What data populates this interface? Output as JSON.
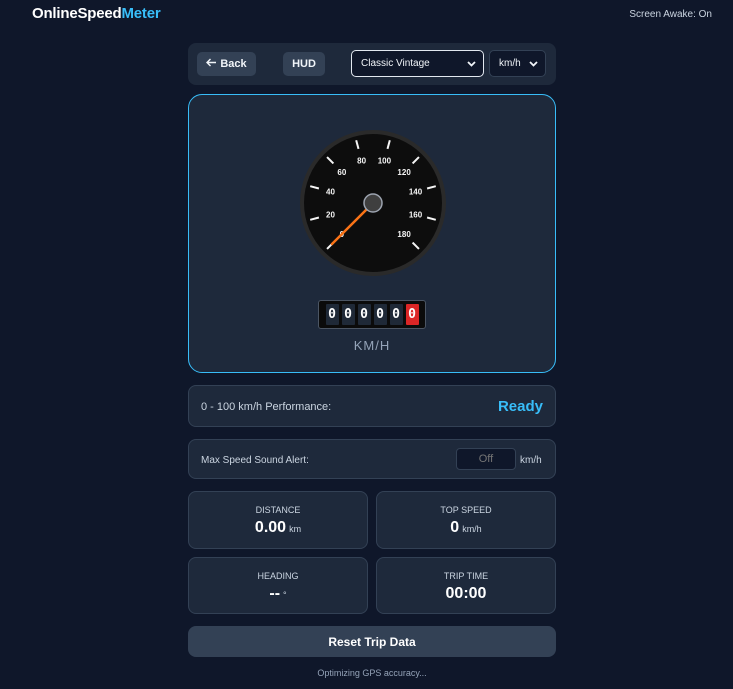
{
  "header": {
    "logo_part1": "OnlineSpeed",
    "logo_part2": "Meter",
    "screen_awake": "Screen Awake: On"
  },
  "toolbar": {
    "back_label": "Back",
    "hud_label": "HUD",
    "theme_selected": "Classic Vintage",
    "unit_selected": "km/h"
  },
  "gauge": {
    "ticks": [
      "0",
      "20",
      "40",
      "60",
      "80",
      "100",
      "120",
      "140",
      "160",
      "180"
    ],
    "speed": 0,
    "odometer_digits": [
      "0",
      "0",
      "0",
      "0",
      "0",
      "0"
    ],
    "unit": "KM/H"
  },
  "performance": {
    "label": "0 - 100 km/h Performance:",
    "status": "Ready"
  },
  "alert": {
    "label": "Max Speed Sound Alert:",
    "placeholder": "Off",
    "unit": "km/h"
  },
  "stats": {
    "distance": {
      "label": "Distance",
      "value": "0.00",
      "unit": "km"
    },
    "top_speed": {
      "label": "Top Speed",
      "value": "0",
      "unit": "km/h"
    },
    "heading": {
      "label": "Heading",
      "value": "--",
      "unit": "°"
    },
    "trip_time": {
      "label": "Trip Time",
      "value": "00:00"
    }
  },
  "reset_label": "Reset Trip Data",
  "gps_status": "Optimizing GPS accuracy...",
  "colors": {
    "background": "#0f172a",
    "card": "#1e293b",
    "accent": "#38bdf8",
    "needle": "#f97316",
    "odometer_last": "#dc2626"
  }
}
